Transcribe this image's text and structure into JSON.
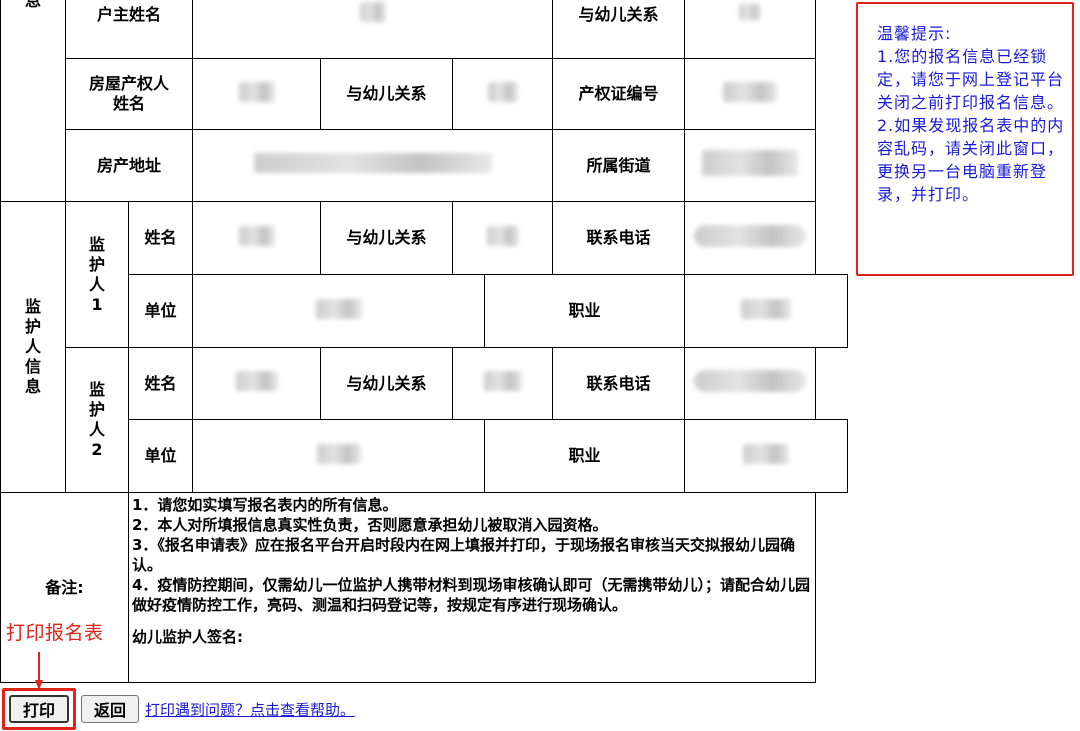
{
  "form": {
    "section_top": "信息",
    "household_head_label": "户主姓名",
    "relation_label": "与幼儿关系",
    "owner_label": "房屋产权人姓名",
    "cert_no_label": "产权证编号",
    "address_label": "房产地址",
    "street_label": "所属街道",
    "guardian_section": "监护人信息",
    "guardian1_label": "监护人1",
    "guardian2_label": "监护人2",
    "name_label": "姓名",
    "phone_label": "联系电话",
    "employer_label": "单位",
    "job_label": "职业",
    "notes_label": "备注:",
    "notes": [
      "1．请您如实填写报名表内的所有信息。",
      "2．本人对所填报信息真实性负责，否则愿意承担幼儿被取消入园资格。",
      "3．《报名申请表》应在报名平台开启时段内在网上填报并打印，于现场报名审核当天交拟报幼儿园确认。",
      "4．疫情防控期间，仅需幼儿一位监护人携带材料到现场审核确认即可（无需携带幼儿）；请配合幼儿园做好疫情防控工作，亮码、测温和扫码登记等，按规定有序进行现场确认。"
    ],
    "signature_label": "幼儿监护人签名:"
  },
  "tip": {
    "title": "温馨提示:",
    "line1": "1.您的报名信息已经锁定，请您于网上登记平台关闭之前打印报名信息。",
    "line2": "2.如果发现报名表中的内容乱码，请关闭此窗口，更换另一台电脑重新登录，并打印。"
  },
  "annotation": {
    "print_hint": "打印报名表"
  },
  "actions": {
    "print": "打印",
    "back": "返回",
    "help_link": "打印遇到问题？点击查看帮助。"
  },
  "colors": {
    "highlight_red": "#e2231a",
    "tip_text_blue": "#1a1ad6"
  }
}
